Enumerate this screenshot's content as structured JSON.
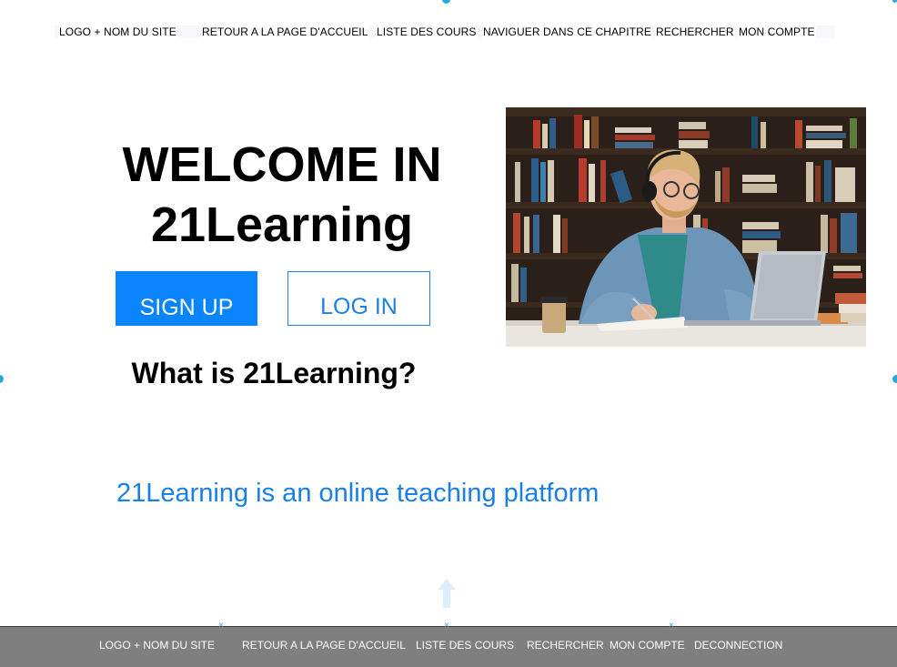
{
  "top_nav": {
    "items": [
      "LOGO + NOM DU SITE",
      "RETOUR A LA PAGE D'ACCUEIL",
      "LISTE DES COURS",
      "NAVIGUER DANS CE CHAPITRE",
      "RECHERCHER",
      "MON COMPTE"
    ]
  },
  "hero": {
    "title_line1": "WELCOME IN",
    "title_line2": "21Learning",
    "signup_label": "SIGN UP",
    "login_label": "LOG IN",
    "subtitle": "What is 21Learning?",
    "tagline": "21Learning is an online teaching platform"
  },
  "bottom_nav": {
    "items": [
      "LOGO + NOM DU SITE",
      "RETOUR A LA PAGE D'ACCUEIL",
      "LISTE DES COURS",
      "RECHERCHER",
      "MON COMPTE",
      "DECONNECTION"
    ]
  },
  "colors": {
    "accent": "#0a84ff",
    "link": "#1a7fe6",
    "footer_bg": "#7f7f7f",
    "handle": "#29a8e0"
  }
}
